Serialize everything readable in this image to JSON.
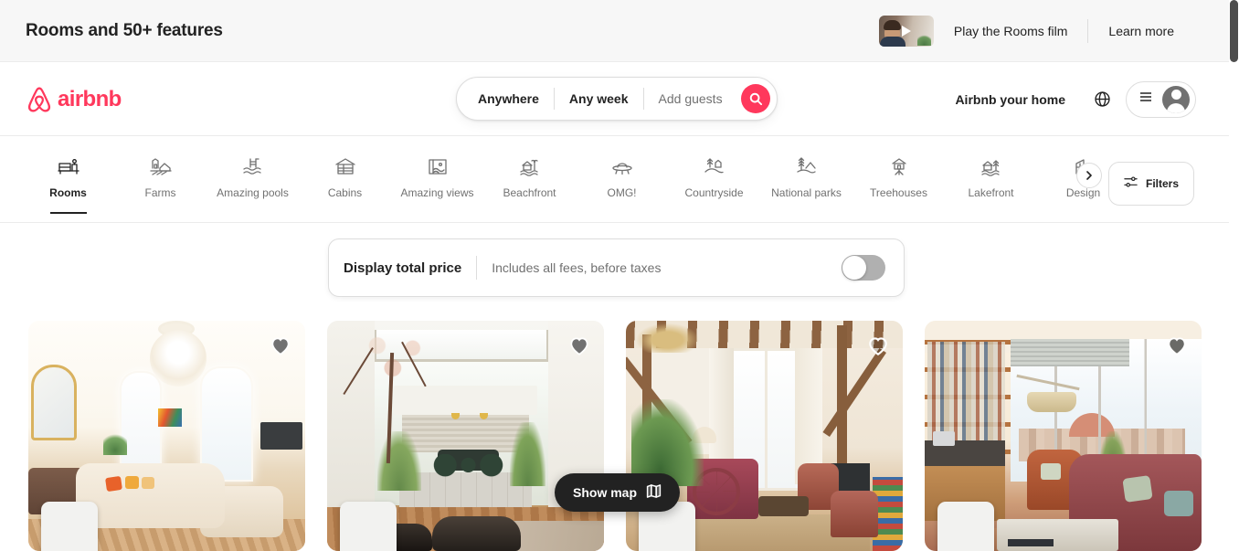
{
  "promo": {
    "title": "Rooms and 50+ features",
    "video_icon": "play-icon",
    "play_label": "Play the Rooms film",
    "learn_label": "Learn more"
  },
  "header": {
    "logo_text": "airbnb",
    "logo_icon": "airbnb-belo-icon",
    "logo_color": "#FF385C",
    "search": {
      "where": "Anywhere",
      "when": "Any week",
      "guests_placeholder": "Add guests",
      "search_icon": "search-icon"
    },
    "host_link": "Airbnb your home",
    "globe_icon": "globe-icon",
    "menu_icon": "hamburger-menu-icon",
    "avatar_icon": "user-avatar-icon"
  },
  "categories": {
    "active": "Rooms",
    "items": [
      {
        "label": "Rooms",
        "icon": "rooms-icon"
      },
      {
        "label": "Farms",
        "icon": "farms-icon"
      },
      {
        "label": "Amazing pools",
        "icon": "amazing-pools-icon"
      },
      {
        "label": "Cabins",
        "icon": "cabins-icon"
      },
      {
        "label": "Amazing views",
        "icon": "amazing-views-icon"
      },
      {
        "label": "Beachfront",
        "icon": "beachfront-icon"
      },
      {
        "label": "OMG!",
        "icon": "omg-ufo-icon"
      },
      {
        "label": "Countryside",
        "icon": "countryside-icon"
      },
      {
        "label": "National parks",
        "icon": "national-parks-icon"
      },
      {
        "label": "Treehouses",
        "icon": "treehouses-icon"
      },
      {
        "label": "Lakefront",
        "icon": "lakefront-icon"
      },
      {
        "label": "Design",
        "icon": "design-icon"
      }
    ],
    "next_icon": "chevron-right-icon",
    "filters_label": "Filters",
    "filters_icon": "filters-sliders-icon"
  },
  "price_panel": {
    "title": "Display total price",
    "subtitle": "Includes all fees, before taxes",
    "toggle_state": "off"
  },
  "listings": [
    {
      "heart_icon": "heart-icon",
      "heart_state": "filled-gray",
      "host_avatar": "host-avatar-1",
      "photo": "bright-parisian-living-room"
    },
    {
      "heart_icon": "heart-icon",
      "heart_state": "filled-gray",
      "host_avatar": "host-avatar-2",
      "photo": "modern-courtyard-garden-home"
    },
    {
      "heart_icon": "heart-icon",
      "heart_state": "outline-white",
      "host_avatar": "host-avatar-3",
      "photo": "rustic-timber-frame-room"
    },
    {
      "heart_icon": "heart-icon",
      "heart_state": "filled-gray",
      "host_avatar": "host-avatar-4",
      "photo": "sunlit-apartment-with-bookshelves"
    }
  ],
  "map_button": {
    "label": "Show map",
    "icon": "map-icon"
  }
}
